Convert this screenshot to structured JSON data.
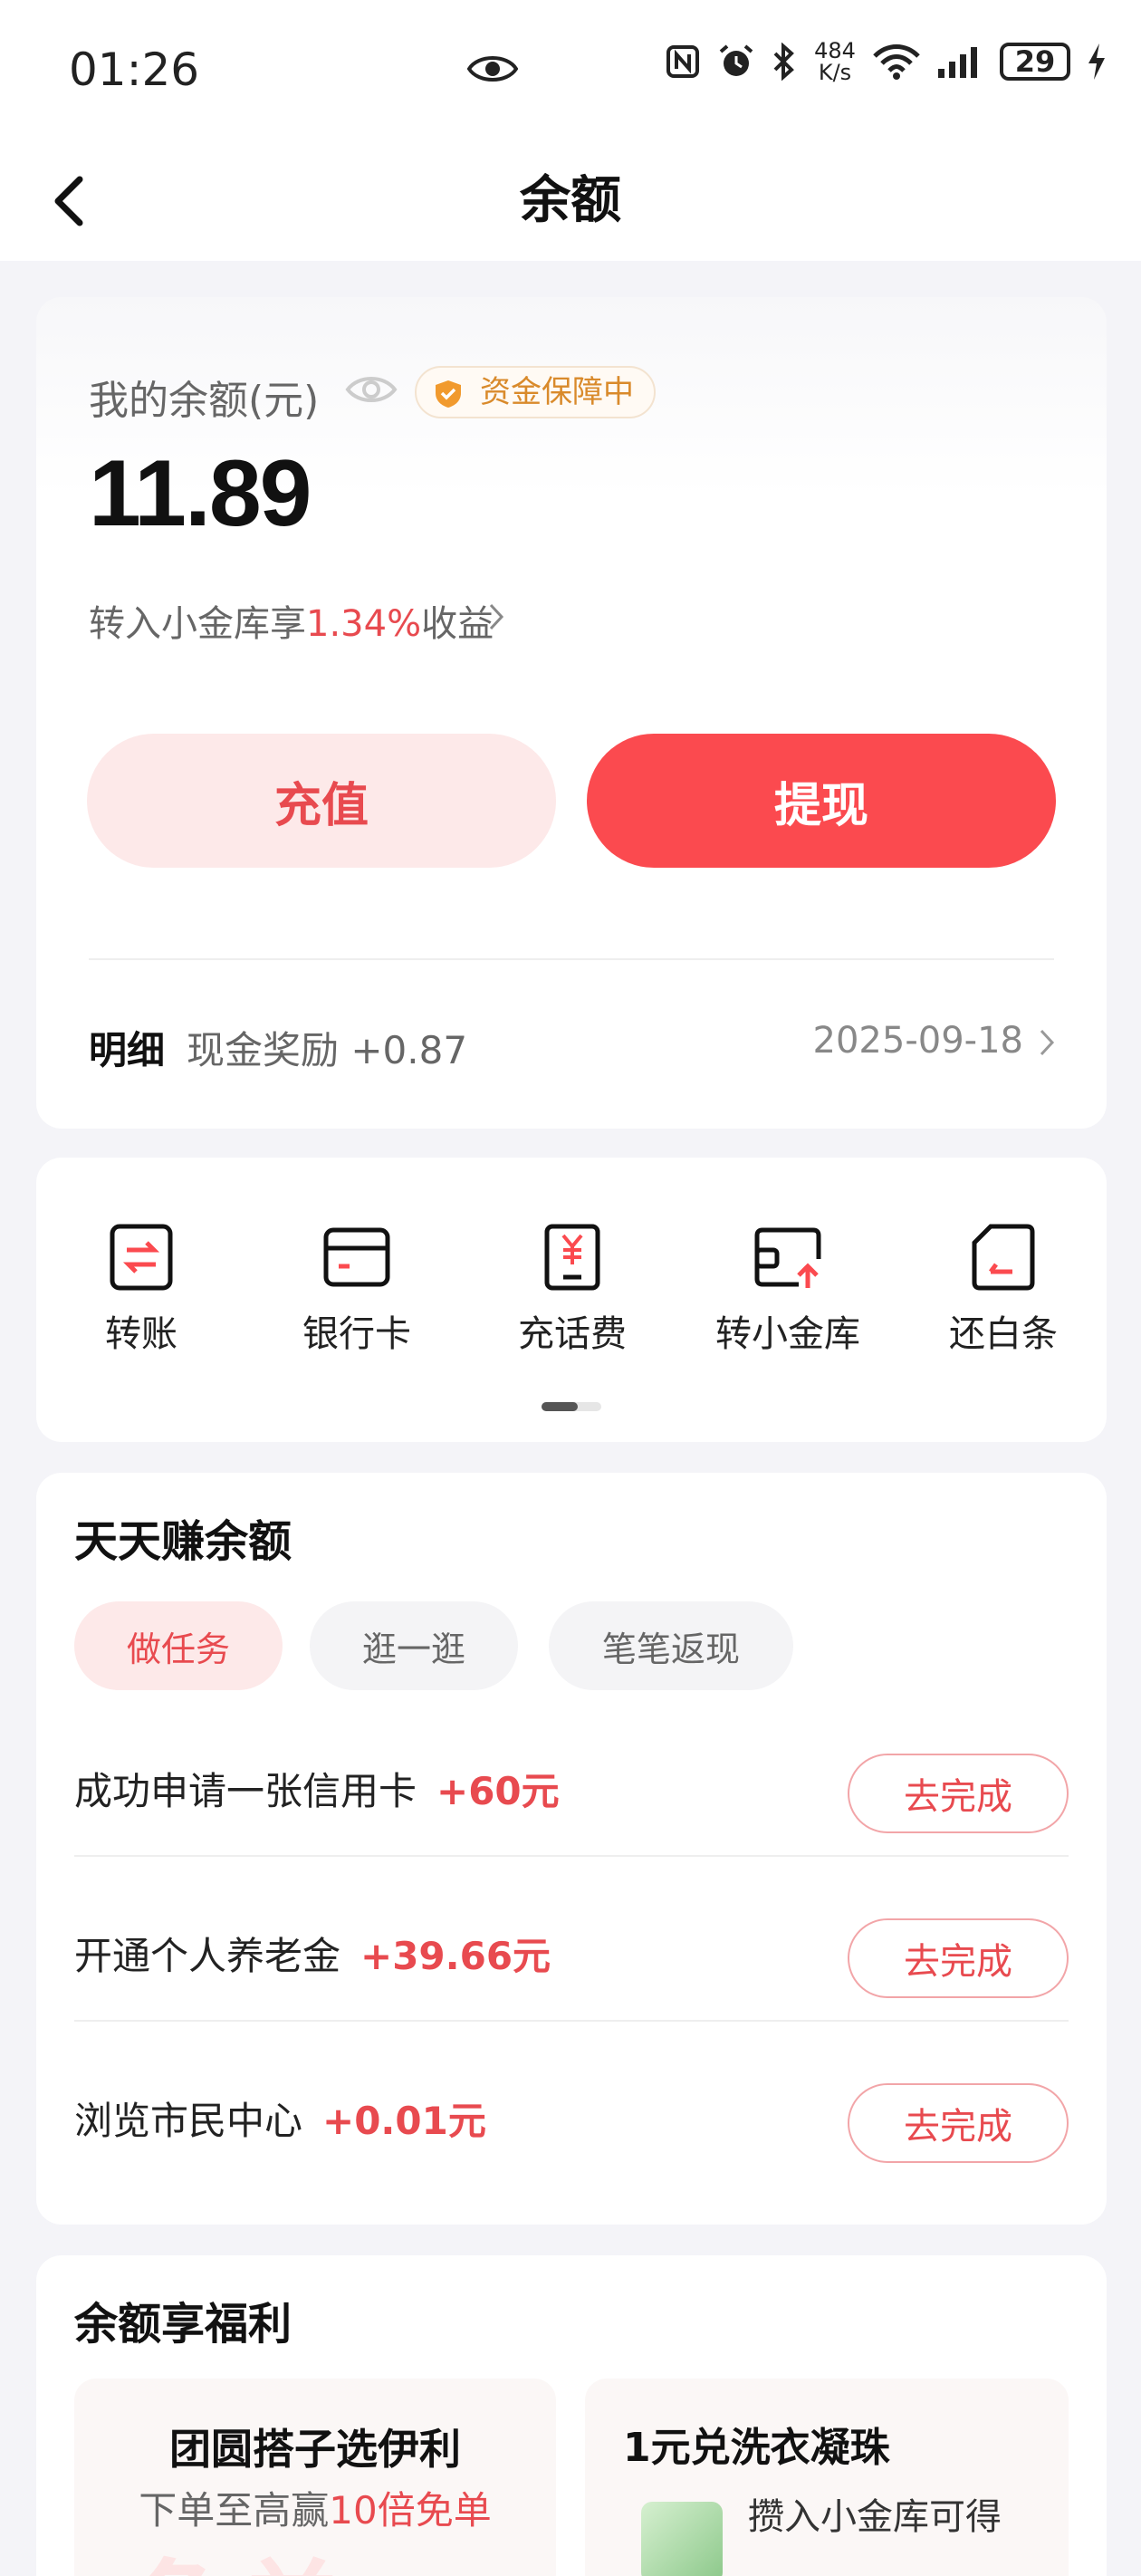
{
  "status_bar": {
    "time": "01:26",
    "net_speed_value": "484",
    "net_speed_unit": "K/s",
    "battery": "29"
  },
  "nav": {
    "title": "余额"
  },
  "balance": {
    "label": "我的余额(元)",
    "guarantee_badge": "资金保障中",
    "amount": "11.89",
    "promo_prefix": "转入小金库享",
    "promo_rate": "1.34%",
    "promo_suffix": "收益",
    "recharge_label": "充值",
    "withdraw_label": "提现",
    "detail_label": "明细",
    "detail_text": "现金奖励 +0.87",
    "detail_date": "2025-09-18"
  },
  "quick_actions": [
    {
      "label": "转账",
      "icon": "transfer-icon"
    },
    {
      "label": "银行卡",
      "icon": "bank-card-icon"
    },
    {
      "label": "充话费",
      "icon": "phone-bill-icon"
    },
    {
      "label": "转小金库",
      "icon": "vault-transfer-icon"
    },
    {
      "label": "还白条",
      "icon": "repay-icon"
    }
  ],
  "earn": {
    "title": "天天赚余额",
    "tabs": [
      "做任务",
      "逛一逛",
      "笔笔返现"
    ],
    "active_tab": 0,
    "tasks": [
      {
        "title": "成功申请一张信用卡",
        "reward": "+60元",
        "button": "去完成"
      },
      {
        "title": "开通个人养老金",
        "reward": "+39.66元",
        "button": "去完成"
      },
      {
        "title": "浏览市民中心",
        "reward": "+0.01元",
        "button": "去完成"
      }
    ]
  },
  "welfare": {
    "title": "余额享福利",
    "tile1_title": "团圆搭子选伊利",
    "tile1_sub_prefix": "下单至高赢",
    "tile1_sub_highlight": "10倍免单",
    "tile1_bg_text": "免单",
    "tile2_title": "1元兑洗衣凝珠",
    "tile2_sub": "攒入小金库可得"
  },
  "colors": {
    "accent": "#fb4a4f",
    "accent_soft": "#fde9e9",
    "text_primary": "#111111",
    "text_secondary": "#666666",
    "badge_orange": "#d98a2b"
  }
}
